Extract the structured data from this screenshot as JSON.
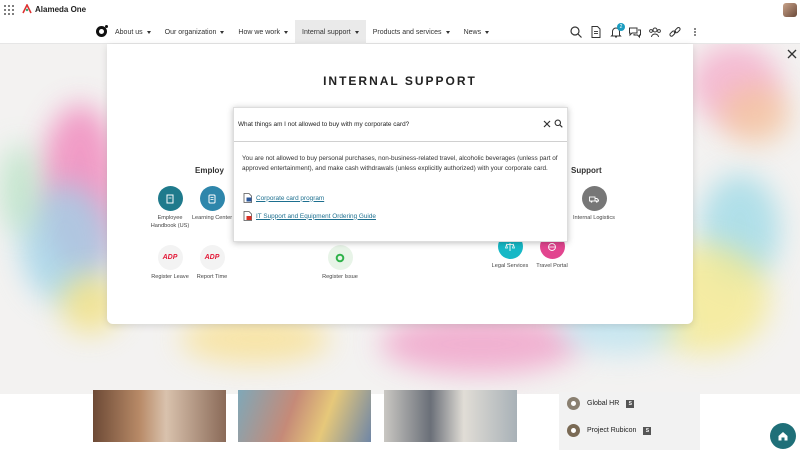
{
  "app": {
    "brand": "Alameda One"
  },
  "nav": {
    "items": [
      {
        "label": "About us"
      },
      {
        "label": "Our organization"
      },
      {
        "label": "How we work"
      },
      {
        "label": "Internal support"
      },
      {
        "label": "Products and services"
      },
      {
        "label": "News"
      }
    ],
    "notification_count": "2"
  },
  "modal": {
    "title": "INTERNAL SUPPORT"
  },
  "groups": {
    "left": "Employ",
    "right": "Support"
  },
  "tiles": {
    "employee_handbook": "Employee Handbook (US)",
    "learning_center": "Learning Center",
    "register_leave": "Register Leave",
    "report_time": "Report Time",
    "register_issue": "Register Issue",
    "legal_services": "Legal Services",
    "travel_portal": "Travel Portal",
    "internal_logistics": "Internal Logistics",
    "adp_logo": "ADP"
  },
  "search": {
    "query": "What things am I not allowed to buy with my corporate card?",
    "answer": "You are not allowed to buy personal purchases, non-business-related travel, alcoholic beverages (unless part of approved entertainment), and make cash withdrawals (unless explicitly authorized) with your corporate card.",
    "results": [
      {
        "label": "Corporate card program",
        "icon": "word-doc-icon"
      },
      {
        "label": "IT Support and Equipment Ordering Guide",
        "icon": "pdf-doc-icon"
      }
    ]
  },
  "side_list": {
    "items": [
      {
        "label": "Global HR"
      },
      {
        "label": "Project Rubicon"
      }
    ]
  },
  "colors": {
    "handbook": "#1f7a8c",
    "learning": "#2e86ab",
    "logistics": "#777777",
    "legal": "#17b8c6",
    "travel": "#e2458f",
    "issue": "#e8f4e8",
    "link": "#1d6f8f"
  }
}
